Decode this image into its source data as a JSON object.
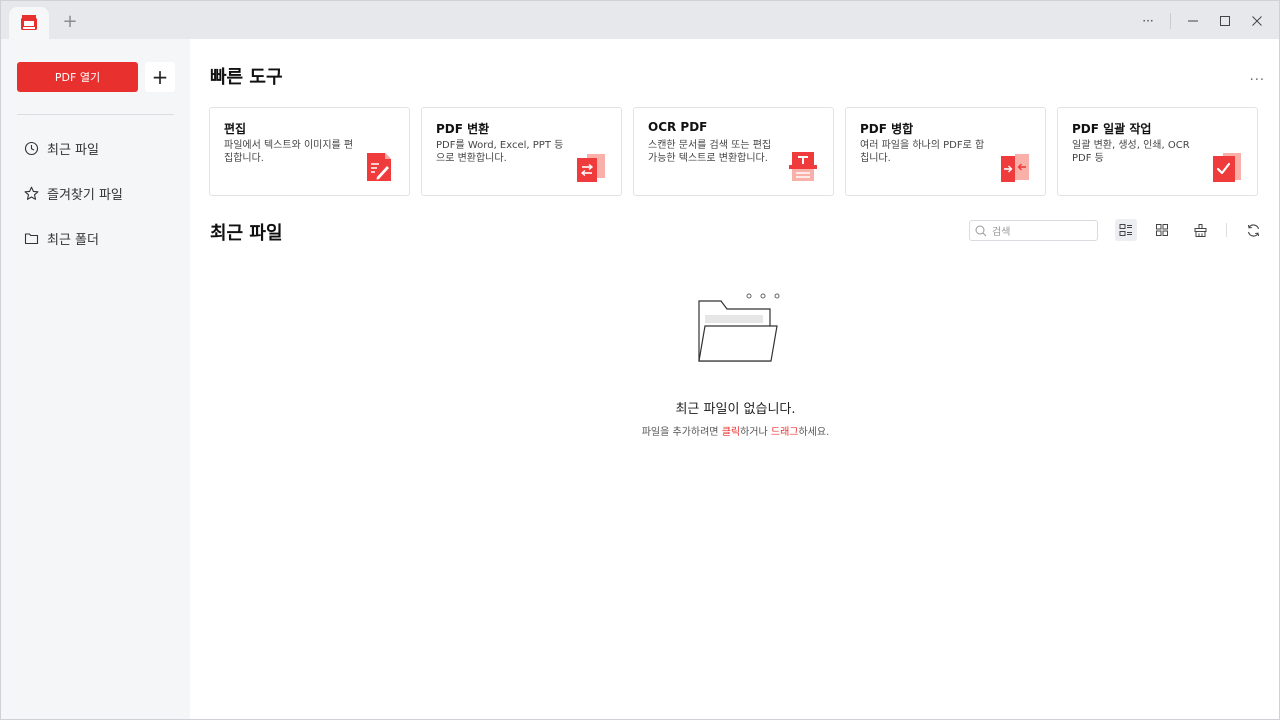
{
  "titlebar": {
    "new_tab": "+",
    "more": "···"
  },
  "sidebar": {
    "open_label": "PDF 열기",
    "add_label": "+",
    "items": [
      {
        "label": "최근 파일",
        "icon": "clock-icon"
      },
      {
        "label": "즐겨찾기 파일",
        "icon": "star-icon"
      },
      {
        "label": "최근 폴더",
        "icon": "folder-icon"
      }
    ]
  },
  "quick_tools": {
    "title": "빠른 도구",
    "more": "···",
    "cards": [
      {
        "title": "편집",
        "desc": "파일에서 텍스트와 이미지를 편집합니다.",
        "icon": "edit-icon"
      },
      {
        "title": "PDF 변환",
        "desc": "PDF를 Word, Excel, PPT 등으로 변환합니다.",
        "icon": "convert-icon"
      },
      {
        "title": "OCR PDF",
        "desc": "스캔한 문서를 검색 또는 편집 가능한 텍스트로 변환합니다.",
        "icon": "ocr-icon"
      },
      {
        "title": "PDF 병합",
        "desc": "여러 파일을 하나의 PDF로 합칩니다.",
        "icon": "merge-icon"
      },
      {
        "title": "PDF 일괄 작업",
        "desc": "일괄 변환, 생성, 인쇄, OCR PDF 등",
        "icon": "batch-icon"
      }
    ]
  },
  "recent": {
    "title": "최근 파일",
    "search_placeholder": "검색",
    "empty_title": "최근 파일이 없습니다.",
    "empty_sub_1": "파일을 추가하려면 ",
    "empty_click": "클릭",
    "empty_sub_2": "하거나 ",
    "empty_drag": "드래그",
    "empty_sub_3": "하세요."
  },
  "colors": {
    "accent": "#e8302e",
    "sidebar_bg": "#f5f6f8",
    "titlebar_bg": "#e7e8ec"
  }
}
